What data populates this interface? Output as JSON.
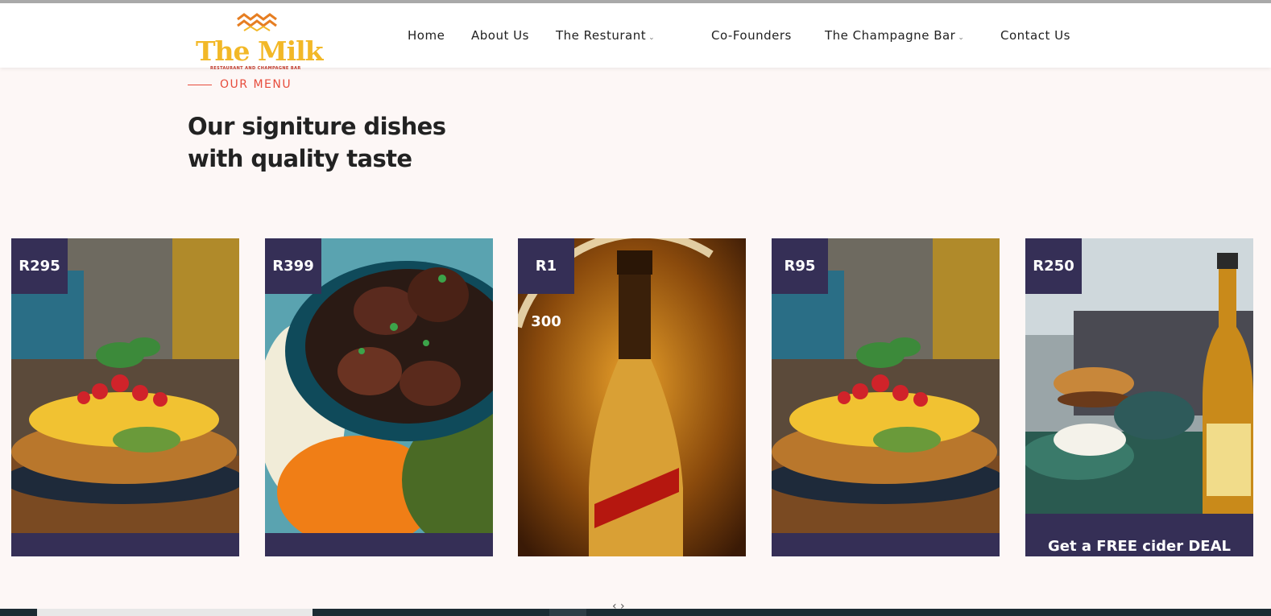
{
  "header": {
    "logo_text": "The Milk",
    "logo_tagline": "RESTAURANT AND CHAMPAGNE BAR",
    "nav": [
      {
        "label": "Home"
      },
      {
        "label": "About Us"
      },
      {
        "label": "The Resturant",
        "has_dropdown": true
      },
      {
        "label": "Co-Founders"
      },
      {
        "label": "The Champagne Bar",
        "has_dropdown": true
      },
      {
        "label": "Contact Us"
      }
    ]
  },
  "section": {
    "eyebrow": "OUR MENU",
    "title_line1": "Our signiture dishes",
    "title_line2": "with quality taste"
  },
  "cards": [
    {
      "price": "R295",
      "caption": "",
      "image": "breakfast-waffle-plate"
    },
    {
      "price": "R399",
      "caption": "",
      "image": "ribs-and-sides-plate"
    },
    {
      "price": "R1 300",
      "caption": "",
      "image": "champagne-bottle"
    },
    {
      "price": "R95",
      "caption": "",
      "image": "breakfast-waffle-plate"
    },
    {
      "price": "R250",
      "caption": "Get a FREE cider DEAL",
      "image": "burger-and-beer"
    }
  ],
  "colors": {
    "accent": "#e74c3c",
    "card_bg": "#352f56",
    "page_bg": "#fdf7f6",
    "logo_gold": "#f2b827"
  }
}
